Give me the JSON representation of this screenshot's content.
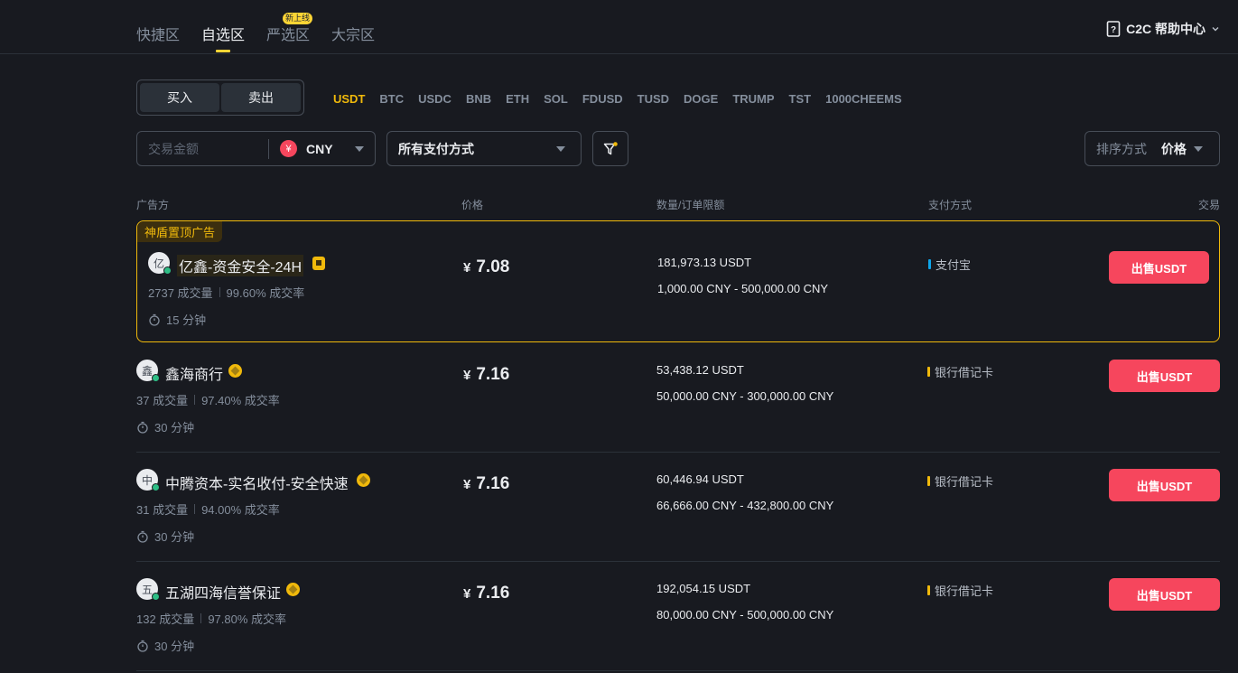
{
  "nav": {
    "tabs": [
      "快捷区",
      "自选区",
      "严选区",
      "大宗区"
    ],
    "new_badge": "新上线",
    "help": "C2C 帮助中心"
  },
  "trade": {
    "buy": "买入",
    "sell": "卖出",
    "coins": [
      "USDT",
      "BTC",
      "USDC",
      "BNB",
      "ETH",
      "SOL",
      "FDUSD",
      "TUSD",
      "DOGE",
      "TRUMP",
      "TST",
      "1000CHEEMS"
    ],
    "active_coin": "USDT"
  },
  "filters": {
    "amount_placeholder": "交易金额",
    "currency_icon": "¥",
    "currency": "CNY",
    "payment": "所有支付方式",
    "sort_label": "排序方式",
    "sort_value": "价格"
  },
  "table": {
    "headers": {
      "advertiser": "广告方",
      "price": "价格",
      "qty": "数量/订单限额",
      "method": "支付方式",
      "trade": "交易"
    },
    "featured_tag": "神盾置顶广告",
    "rows": [
      {
        "avatar": "亿",
        "name": "亿鑫-资金安全-24H",
        "orders": "2737 成交量",
        "rate": "99.60% 成交率",
        "time": "15 分钟",
        "currency_symbol": "¥",
        "price": "7.08",
        "available": "181,973.13 USDT",
        "limit": "1,000.00 CNY - 500,000.00 CNY",
        "method": "支付宝",
        "method_color": "#0ea5e9",
        "action": "出售USDT"
      },
      {
        "avatar": "鑫",
        "name": "鑫海商行",
        "orders": "37 成交量",
        "rate": "97.40% 成交率",
        "time": "30 分钟",
        "currency_symbol": "¥",
        "price": "7.16",
        "available": "53,438.12 USDT",
        "limit": "50,000.00 CNY - 300,000.00 CNY",
        "method": "银行借记卡",
        "method_color": "#f0b90b",
        "action": "出售USDT"
      },
      {
        "avatar": "中",
        "name": "中腾资本-实名收付-安全快速",
        "orders": "31 成交量",
        "rate": "94.00% 成交率",
        "time": "30 分钟",
        "currency_symbol": "¥",
        "price": "7.16",
        "available": "60,446.94 USDT",
        "limit": "66,666.00 CNY - 432,800.00 CNY",
        "method": "银行借记卡",
        "method_color": "#f0b90b",
        "action": "出售USDT"
      },
      {
        "avatar": "五",
        "name": "五湖四海信誉保证",
        "orders": "132 成交量",
        "rate": "97.80% 成交率",
        "time": "30 分钟",
        "currency_symbol": "¥",
        "price": "7.16",
        "available": "192,054.15 USDT",
        "limit": "80,000.00 CNY - 500,000.00 CNY",
        "method": "银行借记卡",
        "method_color": "#f0b90b",
        "action": "出售USDT"
      }
    ]
  }
}
